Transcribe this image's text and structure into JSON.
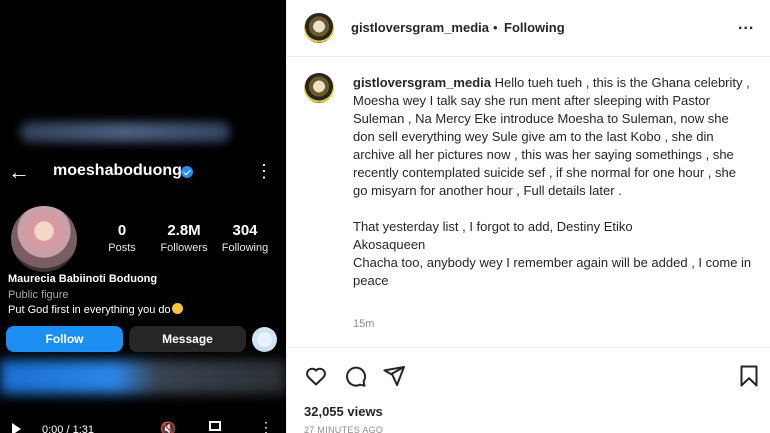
{
  "media": {
    "profile": {
      "handle": "moeshaboduong",
      "posts": {
        "count": "0",
        "label": "Posts"
      },
      "followers": {
        "count": "2.8M",
        "label": "Followers"
      },
      "following": {
        "count": "304",
        "label": "Following"
      },
      "full_name": "Maurecia Babiinoti Boduong",
      "category": "Public figure",
      "bio": "Put God first in everything you do",
      "follow_label": "Follow",
      "message_label": "Message"
    },
    "player": {
      "time": "0:00 / 1:31"
    }
  },
  "post": {
    "header": {
      "username": "gistloversgram_media",
      "separator": "•",
      "follow_status": "Following",
      "more": "..."
    },
    "caption": {
      "username": "gistloversgram_media",
      "text": "Hello tueh tueh , this is the Ghana celebrity , Moesha wey I talk say she run ment after sleeping with Pastor Suleman , Na Mercy Eke introduce Moesha to Suleman, now she don sell everything wey Sule give am to the last Kobo , she din archive all her pictures now , this was her saying somethings , she recently contemplated suicide sef , if she normal for one hour , she go misyarn for another hour , Full details later .",
      "para2": "That yesterday list , I forgot to add, Destiny Etiko",
      "para3": "Akosaqueen",
      "para4": "Chacha too, anybody wey I remember again will be added , I come in peace",
      "time": "15m"
    },
    "views": "32,055 views",
    "posted_ago": "27 MINUTES AGO"
  },
  "icons": [
    "back-arrow-icon",
    "verified-badge-icon",
    "kebab-icon",
    "play-icon",
    "volume-muted-icon",
    "fullscreen-icon",
    "heart-icon",
    "comment-icon",
    "share-icon",
    "bookmark-icon"
  ]
}
